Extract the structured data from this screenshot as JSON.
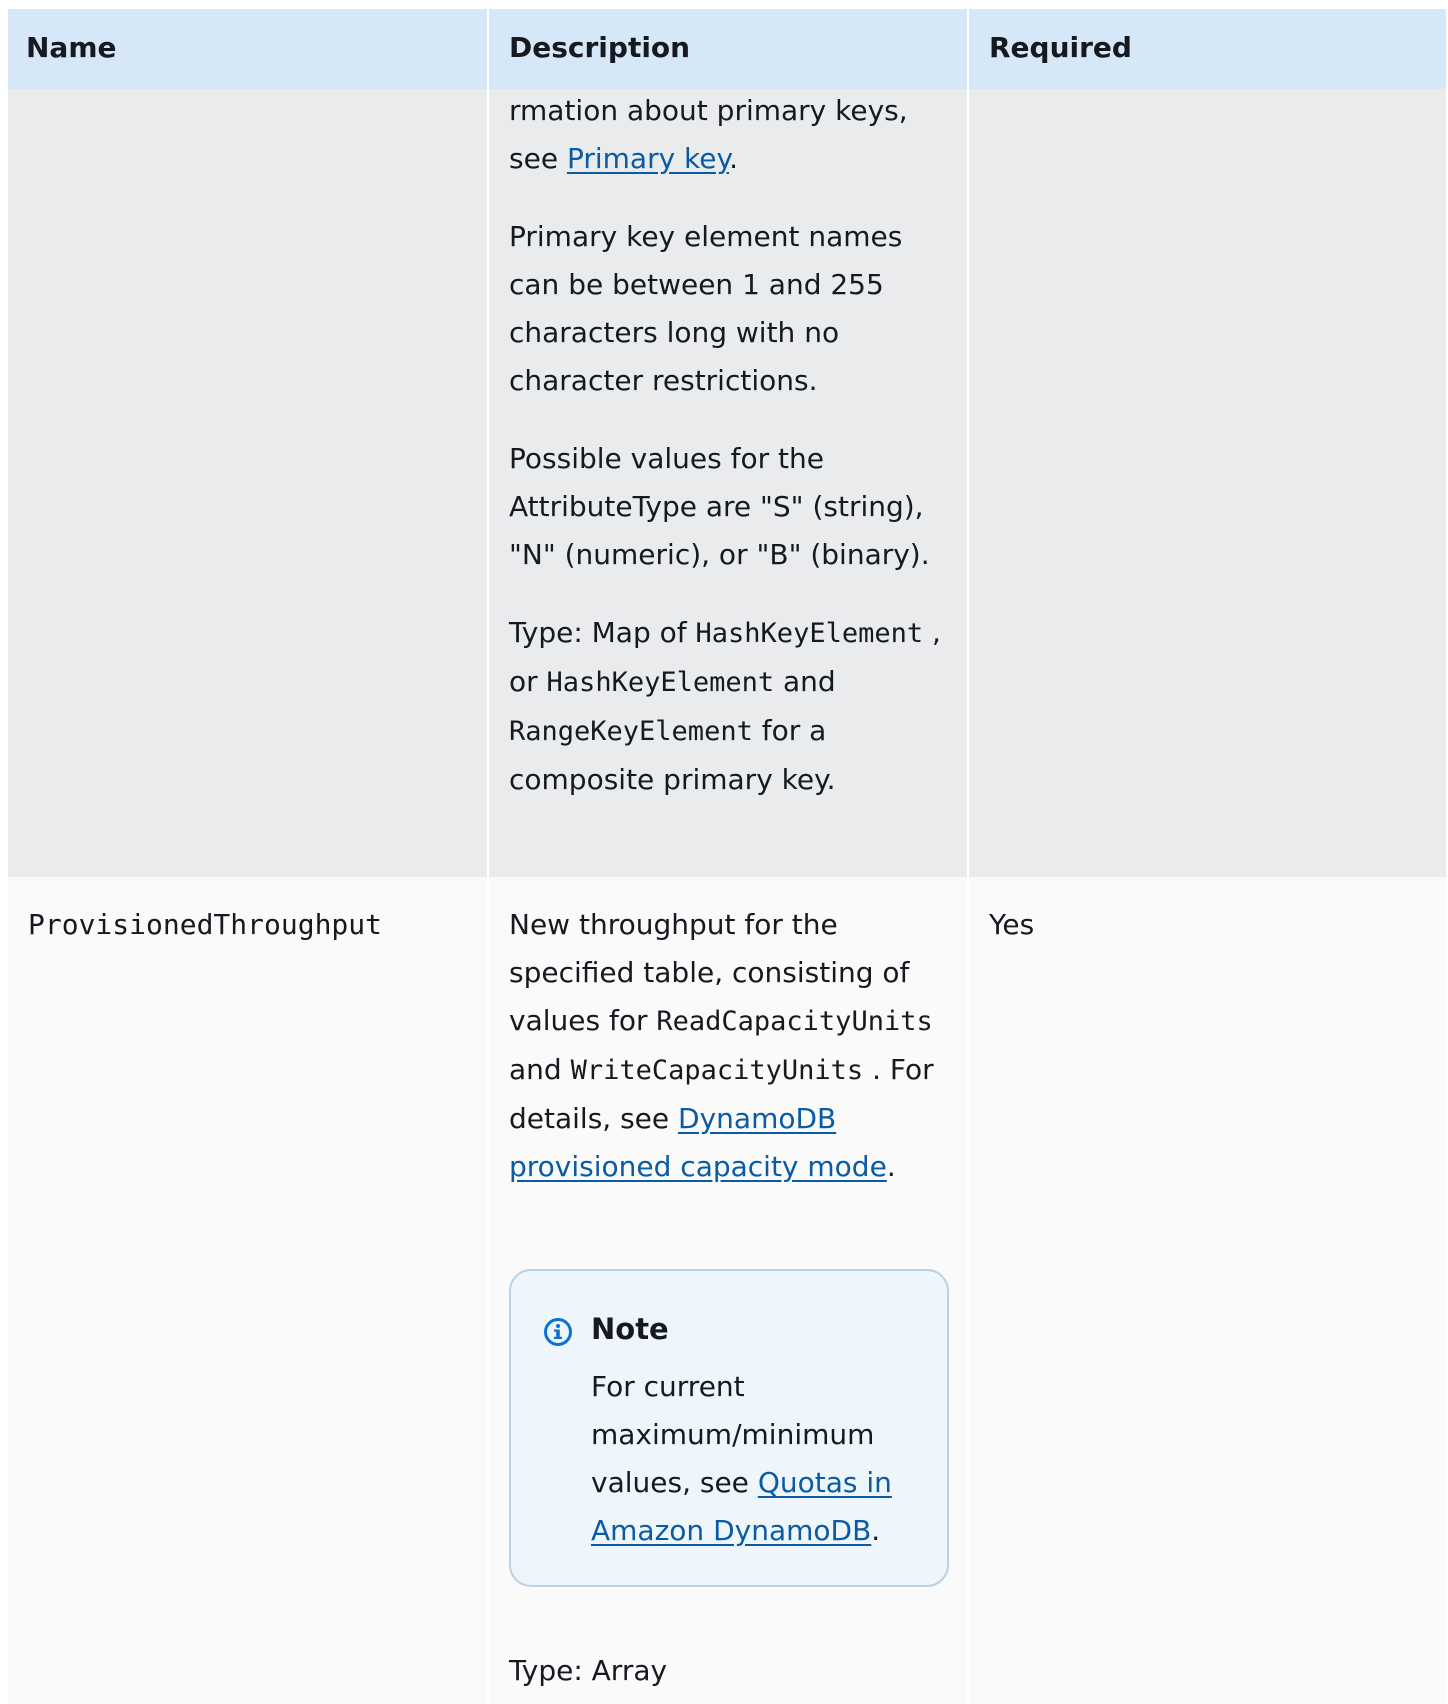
{
  "header": {
    "name": "Name",
    "description": "Description",
    "required": "Required"
  },
  "row1": {
    "desc": {
      "p1_part1": "rmation about primary keys, see ",
      "p1_link": "Primary key",
      "p1_part2": ".",
      "p2": "Primary key element names can be between 1  and 255 characters long with no character  restrictions.",
      "p3": "Possible values for the AttributeType are \"S\" (string), \"N\"  (numeric), or \"B\" (binary).",
      "p4_part1": "Type: Map of ",
      "p4_code1": "HashKeyElement",
      "p4_part2": " , or ",
      "p4_code2": "HashKeyElement",
      "p4_part3": "  and ",
      "p4_code3": "RangeKeyElement",
      "p4_part4": "  for a composite  primary key."
    }
  },
  "row2": {
    "name": "ProvisionedThroughput",
    "required": "Yes",
    "desc": {
      "part1": "New throughput for the specified table, consisting of values for ",
      "code1": "ReadCapacityUnits",
      "part2": "  and ",
      "code2": "WriteCapacityUnits",
      "part3": "  . For details, see ",
      "link": "DynamoDB provisioned capacity mode",
      "part4": "."
    },
    "note": {
      "icon": "info-icon",
      "title": "Note",
      "body_part1": "For current maximum/minimum values, see ",
      "link": "Quotas in Amazon DynamoDB",
      "body_part2": "."
    },
    "type_line": "Type: Array"
  },
  "colors": {
    "header_bg": "#d6e7f8",
    "row1_bg": "#e9ebed",
    "row2_bg": "#fafafa",
    "link": "#0a5aa4",
    "note_bg": "#eef6fc",
    "note_border": "#b7d2e8",
    "info_icon": "#0972d3"
  }
}
